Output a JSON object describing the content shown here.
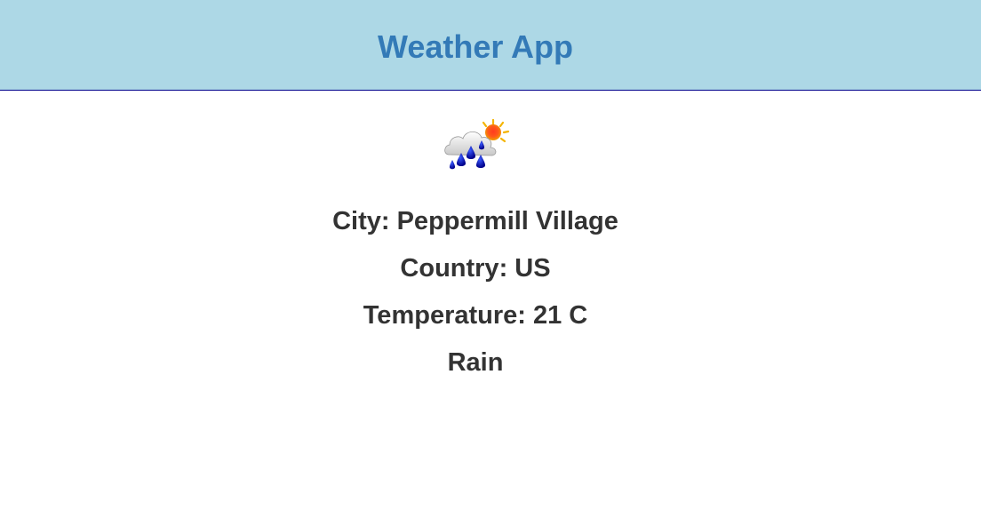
{
  "header": {
    "title": "Weather App",
    "background_color": "#add8e6",
    "title_color": "#337ab7"
  },
  "weather": {
    "icon": "rain-cloud-sun-icon",
    "city_text": "City: Peppermill Village",
    "country_text": "Country: US",
    "temperature_text": "Temperature: 21 C",
    "condition_text": "Rain"
  }
}
